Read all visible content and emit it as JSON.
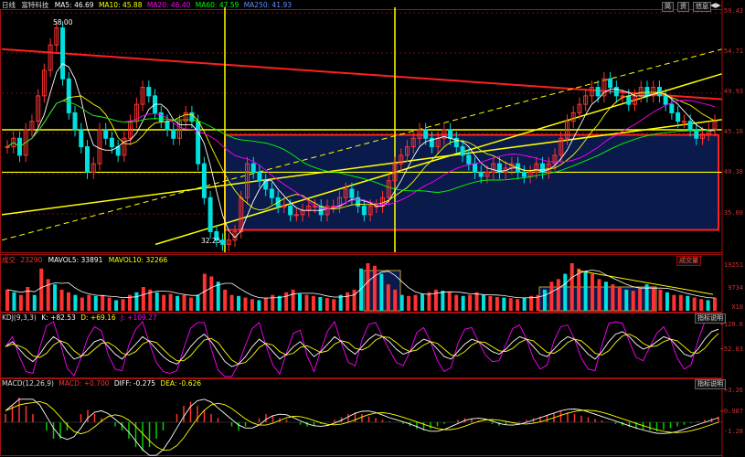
{
  "header": {
    "period": "日线",
    "stock": "富特科技",
    "ma5": "MA5: 46.69",
    "ma10": "MA10: 45.88",
    "ma20": "MA20: 46.40",
    "ma60": "MA60: 47.59",
    "ma250": "MA250: 41.93",
    "buttons": [
      "简",
      "资",
      "信息"
    ]
  },
  "price_axis": [
    "59.43",
    "54.71",
    "49.93",
    "45.16",
    "40.38",
    "35.60"
  ],
  "price_marks": {
    "high": "58.00",
    "low": "32.25"
  },
  "volume_header": {
    "label": "成交",
    "value": "23290",
    "mavol5": "MAVOL5: 33891",
    "mavol10": "MAVOL10: 32266",
    "tab": "成交量"
  },
  "volume_axis": [
    "19251",
    "9734",
    "X10"
  ],
  "kdj_header": {
    "label": "KDJ(9,3,3)",
    "k": "K: +82.53",
    "d": "D: +69.16",
    "j": "J: +109.27",
    "tab": "指标说明"
  },
  "kdj_axis": [
    "+120.6",
    "+52.83"
  ],
  "macd_header": {
    "label": "MACD(12,26,9)",
    "macd": "MACD: +0.700",
    "diff": "DIFF: -0.275",
    "dea": "DEA: -0.626",
    "tab": "指标说明"
  },
  "macd_axis": [
    "+3.26",
    "+0.987",
    "-1.28"
  ],
  "colors": {
    "up": "#ff3232",
    "down": "#00e0e0",
    "ma5": "#ffffff",
    "ma10": "#ffff00",
    "ma20": "#ff00ff",
    "ma60": "#00ff00",
    "ma250": "#4080ff",
    "trend": "#ffff00",
    "box": "#ff2020"
  },
  "chart_data": {
    "type": "candlestick",
    "panels": [
      "price",
      "volume",
      "kdj",
      "macd"
    ],
    "ylim_price": [
      32,
      60
    ],
    "price_high": 58.0,
    "price_low": 32.25,
    "close_series": [
      44,
      45,
      43,
      46,
      47,
      50,
      53,
      56,
      58,
      52,
      48,
      46,
      44,
      41,
      42,
      46,
      45,
      44,
      43,
      45,
      47,
      49,
      51,
      50,
      48,
      47,
      46,
      45,
      47,
      48,
      47,
      42,
      38,
      34,
      33,
      32.5,
      33,
      34,
      38,
      42,
      41,
      40,
      39,
      38,
      37,
      37,
      36,
      36,
      36.5,
      37,
      37,
      36,
      37,
      37,
      38,
      39,
      38,
      37,
      36,
      37,
      37,
      38,
      40,
      42,
      43,
      44,
      45,
      46,
      45,
      44,
      45,
      46,
      45,
      44,
      43,
      42,
      41,
      40.5,
      41,
      42,
      41,
      41.5,
      42,
      41,
      40.5,
      41,
      42,
      41,
      42,
      43,
      45,
      47,
      48,
      49,
      50,
      51,
      50,
      52,
      51,
      50,
      50,
      49,
      50,
      51,
      50,
      51,
      50,
      49,
      48,
      47,
      47,
      46,
      45,
      45.5,
      46,
      47
    ],
    "volume_series": [
      40,
      35,
      30,
      45,
      30,
      80,
      60,
      50,
      40,
      35,
      30,
      25,
      30,
      28,
      30,
      25,
      20,
      22,
      30,
      35,
      45,
      40,
      35,
      30,
      32,
      28,
      30,
      25,
      30,
      70,
      65,
      55,
      40,
      30,
      28,
      25,
      22,
      20,
      25,
      30,
      28,
      35,
      40,
      32,
      30,
      28,
      26,
      24,
      22,
      30,
      35,
      40,
      80,
      90,
      85,
      70,
      50,
      40,
      30,
      28,
      30,
      32,
      35,
      40,
      38,
      35,
      30,
      28,
      30,
      35,
      30,
      28,
      26,
      25,
      24,
      22,
      25,
      28,
      30,
      40,
      55,
      60,
      70,
      90,
      80,
      75,
      70,
      60,
      55,
      50,
      45,
      40,
      38,
      42,
      50,
      45,
      40,
      35,
      30,
      30,
      28,
      25,
      22,
      20,
      25
    ],
    "kdj_k": [
      60,
      70,
      55,
      40,
      30,
      45,
      65,
      80,
      70,
      50,
      35,
      40,
      55,
      70,
      75,
      60,
      45,
      35,
      50,
      65,
      80,
      70,
      55,
      40,
      30,
      25,
      40,
      60,
      75,
      85,
      70,
      50,
      30,
      20,
      25,
      40,
      60,
      75,
      65,
      50,
      35,
      45,
      60,
      70,
      55,
      40,
      50,
      65,
      80,
      70,
      55,
      45,
      60,
      75,
      85,
      80,
      70,
      55,
      45,
      50,
      65,
      75,
      70,
      55,
      40,
      35,
      50,
      65,
      75,
      70,
      60,
      50,
      45,
      55,
      70,
      80,
      75,
      60,
      45,
      40,
      55,
      70,
      80,
      75,
      60,
      45,
      35,
      50,
      70,
      85,
      90,
      80,
      65,
      55,
      60,
      70,
      80,
      75,
      60,
      45,
      40,
      55,
      75,
      90,
      95
    ],
    "macd_hist": [
      1,
      2,
      3,
      2,
      1,
      0,
      -1,
      -2,
      -2,
      -1,
      0,
      1,
      1.5,
      1,
      0.5,
      0,
      -0.5,
      -1,
      -2,
      -3,
      -3.5,
      -3,
      -2,
      -1,
      0,
      1,
      2,
      2.5,
      2,
      1.5,
      1,
      0.5,
      0,
      -0.5,
      -1,
      -0.5,
      0,
      0.5,
      1,
      0.8,
      0.5,
      0.3,
      0,
      -0.3,
      -0.5,
      -0.4,
      -0.2,
      0,
      0.3,
      0.6,
      1,
      1.2,
      1,
      0.7,
      0.5,
      0.3,
      0.1,
      0,
      -0.2,
      -0.5,
      -0.8,
      -1,
      -0.8,
      -0.5,
      -0.2,
      0,
      0.3,
      0.5,
      0.4,
      0.2,
      0,
      -0.2,
      -0.4,
      -0.3,
      -0.1,
      0.1,
      0.3,
      0.5,
      0.7,
      0.9,
      1.1,
      1.3,
      1.2,
      1,
      0.8,
      0.6,
      0.4,
      0.2,
      0,
      -0.2,
      -0.4,
      -0.6,
      -0.8,
      -0.9,
      -1,
      -1.1,
      -0.9,
      -0.7,
      -0.5,
      -0.3,
      -0.1,
      0.1,
      0.3,
      0.5,
      0.7
    ]
  }
}
